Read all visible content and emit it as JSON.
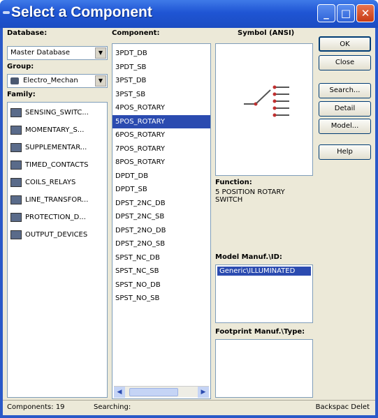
{
  "window": {
    "title": "Select a Component"
  },
  "database": {
    "label": "Database:",
    "value": "Master Database"
  },
  "group": {
    "label": "Group:",
    "value": "Electro_Mechan"
  },
  "family": {
    "label": "Family:",
    "items": [
      {
        "label": "SENSING_SWITC...",
        "icon": "sensing-switch-icon"
      },
      {
        "label": "MOMENTARY_S...",
        "icon": "momentary-switch-icon"
      },
      {
        "label": "SUPPLEMENTAR...",
        "icon": "supplementary-icon"
      },
      {
        "label": "TIMED_CONTACTS",
        "icon": "timed-contacts-icon"
      },
      {
        "label": "COILS_RELAYS",
        "icon": "coil-relay-icon"
      },
      {
        "label": "LINE_TRANSFOR...",
        "icon": "line-transformer-icon"
      },
      {
        "label": "PROTECTION_D...",
        "icon": "protection-device-icon"
      },
      {
        "label": "OUTPUT_DEVICES",
        "icon": "output-devices-icon"
      }
    ]
  },
  "component": {
    "label": "Component:",
    "selected_index": 5,
    "items": [
      "3PDT_DB",
      "3PDT_SB",
      "3PST_DB",
      "3PST_SB",
      "4POS_ROTARY",
      "5POS_ROTARY",
      "6POS_ROTARY",
      "7POS_ROTARY",
      "8POS_ROTARY",
      "DPDT_DB",
      "DPDT_SB",
      "DPST_2NC_DB",
      "DPST_2NC_SB",
      "DPST_2NO_DB",
      "DPST_2NO_SB",
      "SPST_NC_DB",
      "SPST_NC_SB",
      "SPST_NO_DB",
      "SPST_NO_SB"
    ]
  },
  "symbol": {
    "label": "Symbol (ANSI)"
  },
  "function": {
    "label": "Function:",
    "text": "5 POSITION ROTARY SWITCH"
  },
  "model_manuf": {
    "label": "Model Manuf.\\ID:",
    "selected": "Generic\\ILLUMINATED"
  },
  "footprint": {
    "label": "Footprint Manuf.\\Type:"
  },
  "buttons": {
    "ok": "OK",
    "close": "Close",
    "search": "Search...",
    "detail_report": "Detail Report...",
    "model": "Model...",
    "help": "Help"
  },
  "status": {
    "components": "Components: 19",
    "searching": "Searching:",
    "hint": "Backspac Delet"
  }
}
